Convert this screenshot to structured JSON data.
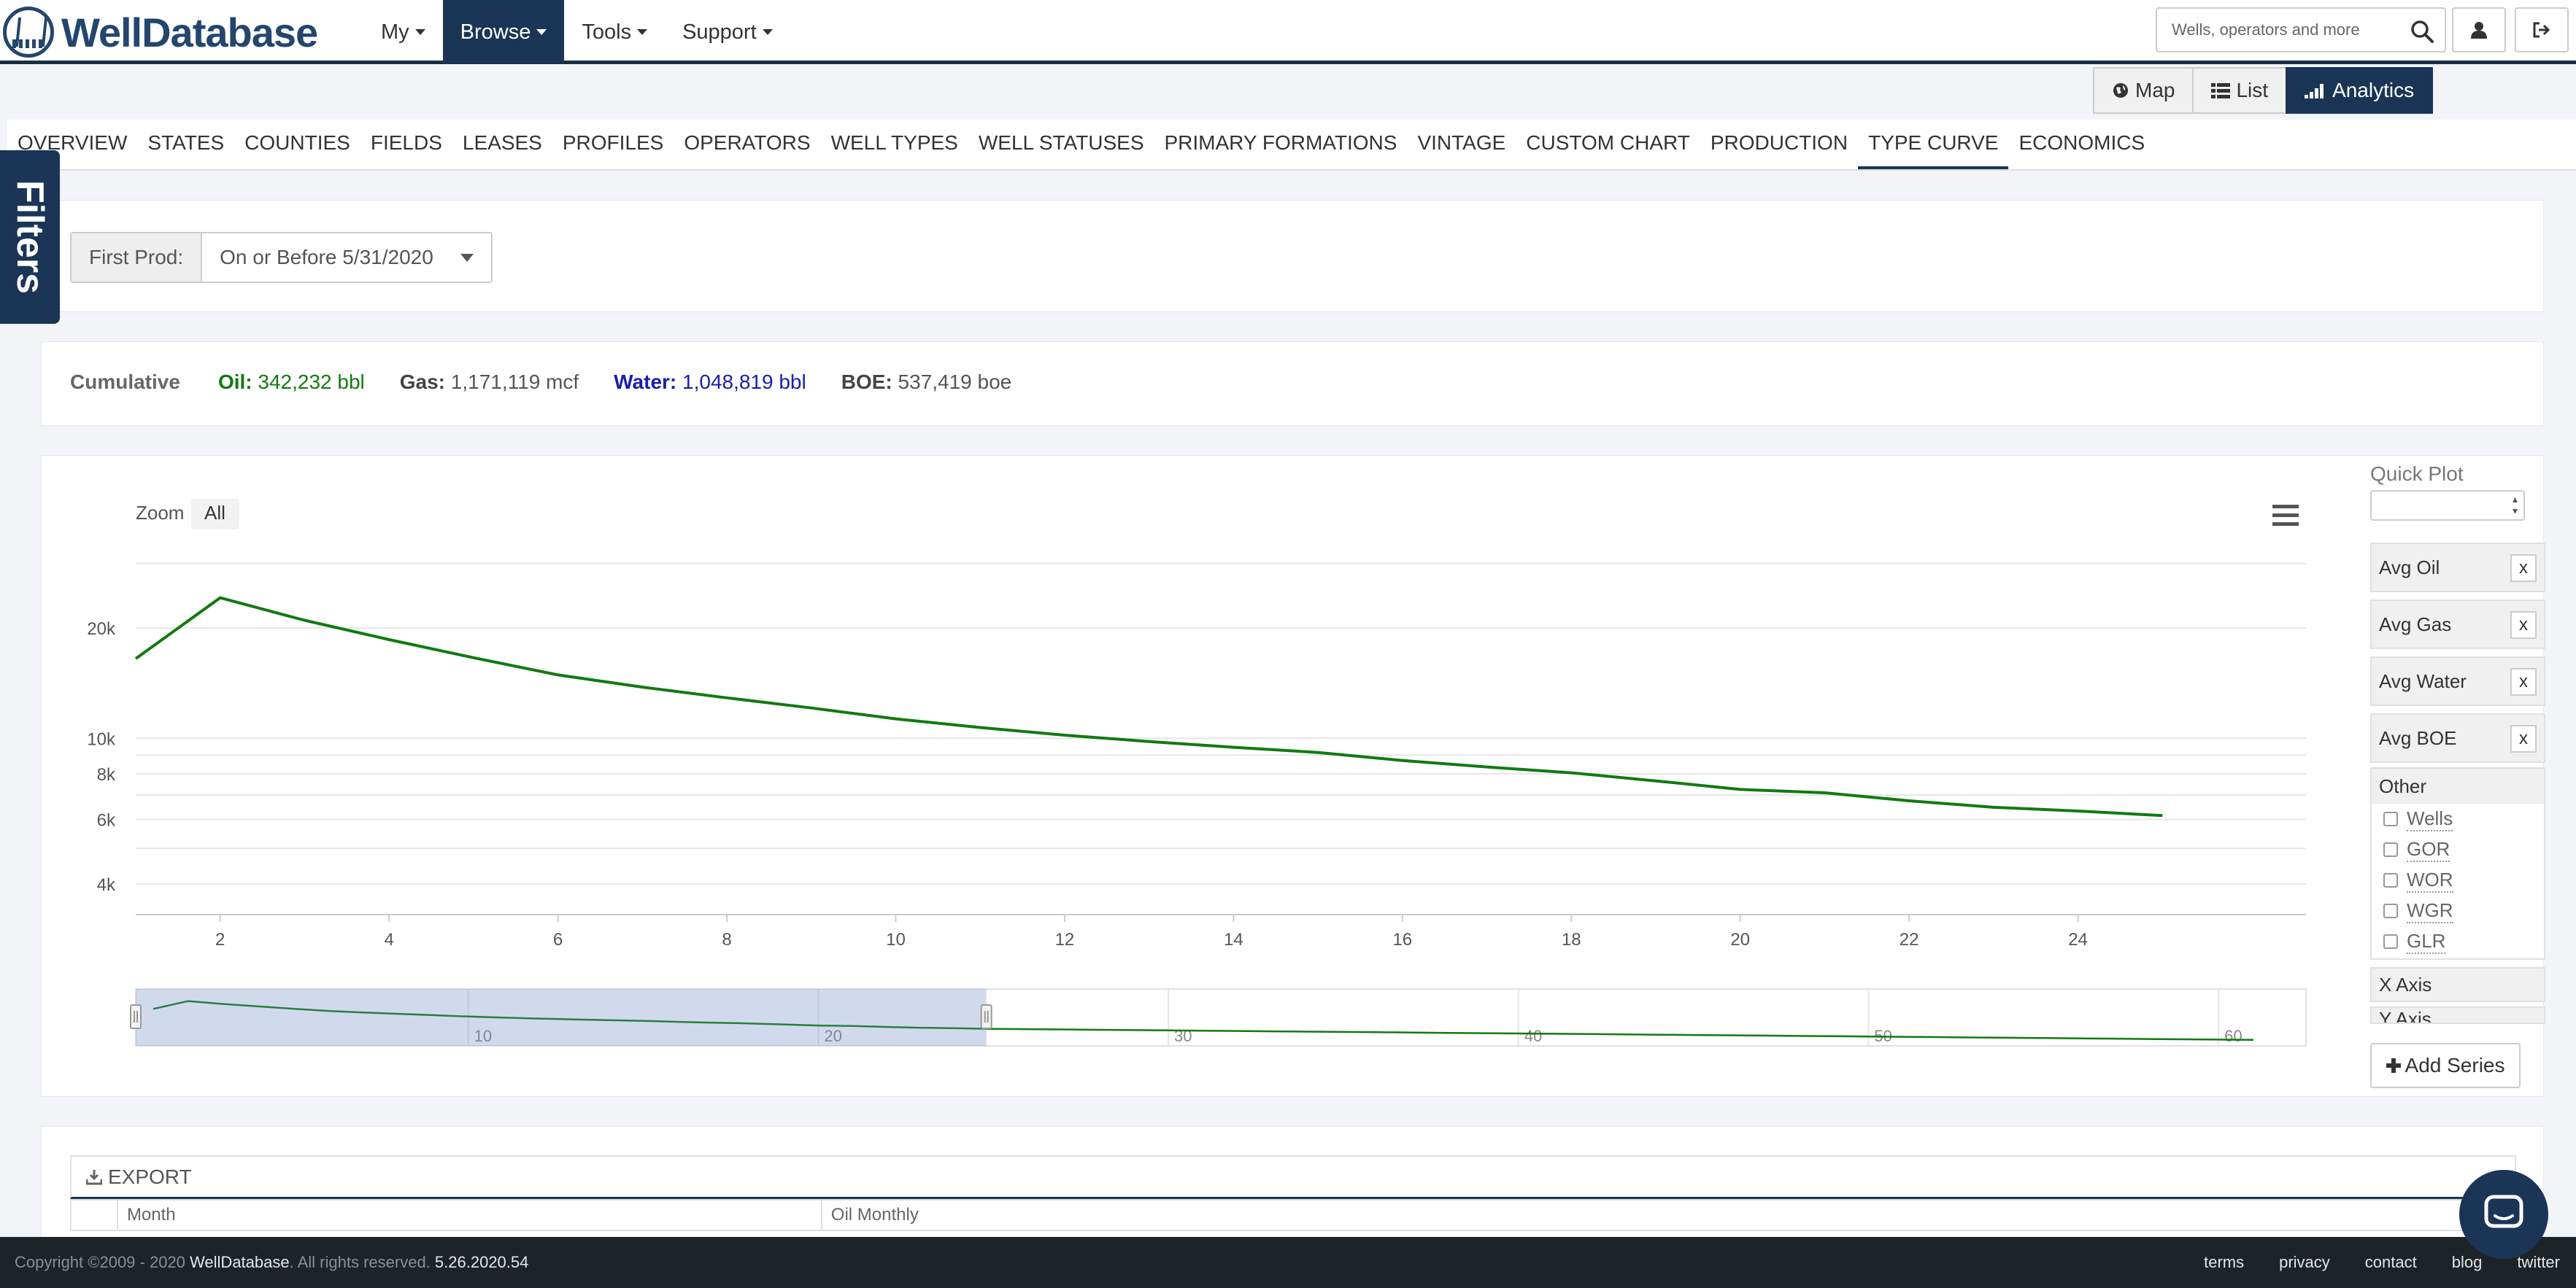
{
  "brand": {
    "name": "WellDatabase"
  },
  "nav": {
    "items": [
      {
        "label": "My"
      },
      {
        "label": "Browse"
      },
      {
        "label": "Tools"
      },
      {
        "label": "Support"
      }
    ],
    "active": "Browse"
  },
  "search": {
    "placeholder": "Wells, operators and more"
  },
  "view_toggle": {
    "map": "Map",
    "list": "List",
    "analytics": "Analytics",
    "active": "Analytics"
  },
  "tabs": [
    "OVERVIEW",
    "STATES",
    "COUNTIES",
    "FIELDS",
    "LEASES",
    "PROFILES",
    "OPERATORS",
    "WELL TYPES",
    "WELL STATUSES",
    "PRIMARY FORMATIONS",
    "VINTAGE",
    "CUSTOM CHART",
    "PRODUCTION",
    "TYPE CURVE",
    "ECONOMICS"
  ],
  "active_tab": "TYPE CURVE",
  "filters": {
    "label": "Filters"
  },
  "first_prod": {
    "label": "First Prod:",
    "value": "On or Before 5/31/2020"
  },
  "cumulative": {
    "label": "Cumulative",
    "oil_label": "Oil:",
    "oil_value": "342,232 bbl",
    "gas_label": "Gas:",
    "gas_value": "1,171,119 mcf",
    "water_label": "Water:",
    "water_value": "1,048,819 bbl",
    "boe_label": "BOE:",
    "boe_value": "537,419 boe"
  },
  "chart_controls": {
    "zoom_label": "Zoom",
    "zoom_all": "All"
  },
  "chart_data": {
    "type": "line",
    "log_y": true,
    "ylim": [
      3300,
      33000
    ],
    "xlim": [
      1,
      26.7
    ],
    "x_ticks": [
      2,
      4,
      6,
      8,
      10,
      12,
      14,
      16,
      18,
      20,
      22,
      24
    ],
    "y_ticks": [
      4000,
      6000,
      8000,
      10000,
      20000
    ],
    "y_tick_labels": [
      "4k",
      "6k",
      "8k",
      "10k",
      "20k"
    ],
    "series": [
      {
        "color": "#117a11",
        "x": [
          1,
          2,
          3,
          4,
          5,
          6,
          7,
          8,
          9,
          10,
          11,
          12,
          13,
          14,
          15,
          16,
          17,
          18,
          19,
          20,
          21,
          22,
          23,
          24,
          25
        ],
        "y": [
          16500,
          24200,
          21000,
          18600,
          16600,
          14900,
          13800,
          12900,
          12100,
          11300,
          10700,
          10200,
          9800,
          9450,
          9150,
          8700,
          8350,
          8050,
          7650,
          7250,
          7100,
          6750,
          6480,
          6330,
          6150
        ]
      }
    ],
    "navigator": {
      "x_ticks": [
        10,
        20,
        30,
        40,
        50,
        60
      ],
      "xlim": [
        0.5,
        62.5
      ],
      "selected_range": [
        1,
        25
      ]
    }
  },
  "side_panel": {
    "quick_plot_label": "Quick Plot",
    "series": [
      "Avg Oil",
      "Avg Gas",
      "Avg Water",
      "Avg BOE"
    ],
    "remove_label": "x",
    "other_label": "Other",
    "other_options": [
      "Wells",
      "GOR",
      "WOR",
      "WGR",
      "GLR"
    ],
    "x_axis_label": "X Axis",
    "y_axis_label": "Y Axis",
    "add_series_label": "Add Series"
  },
  "export": {
    "label": "EXPORT",
    "columns": [
      "",
      "Month",
      "Oil Monthly"
    ]
  },
  "footer": {
    "copyright": "Copyright ©2009 - 2020",
    "brand": "WellDatabase",
    "rights": ". All rights reserved.",
    "version": "5.26.2020.54",
    "links": [
      "terms",
      "privacy",
      "contact",
      "blog",
      "twitter"
    ]
  },
  "colors": {
    "nav_dark": "#1a3556",
    "oil": "#117a11",
    "water": "#1a1ea8"
  }
}
